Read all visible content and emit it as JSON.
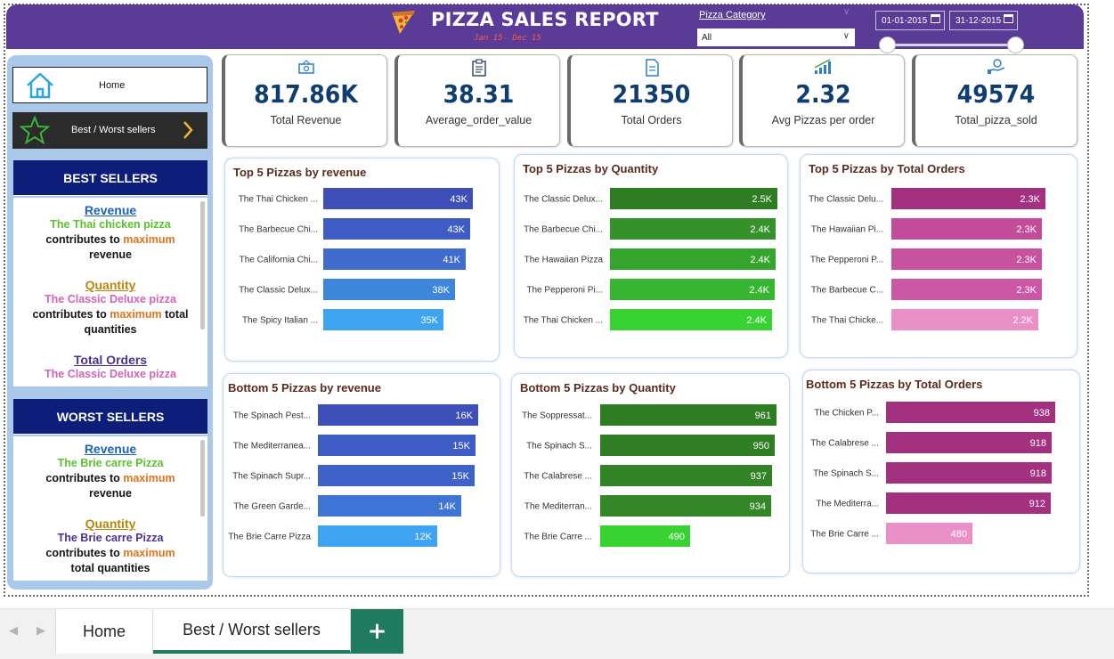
{
  "header": {
    "title": "PIZZA SALES REPORT",
    "subtitle": "Jan 15- Dec 15",
    "category_label": "Pizza Category",
    "category_value": "All",
    "date_from": "01-01-2015",
    "date_to": "31-12-2015",
    "colors": {
      "header_bg": "#5b3b98",
      "subtitle": "#ff5a3c"
    }
  },
  "nav": {
    "home_label": "Home",
    "best_worst_label": "Best / Worst sellers"
  },
  "best_sellers": {
    "header": "BEST SELLERS",
    "revenue_head": "Revenue",
    "revenue_item": "The Thai chicken pizza",
    "revenue_l1": "contributes to ",
    "revenue_l1b": "maximum",
    "revenue_l2": "revenue",
    "quantity_head": "Quantity",
    "quantity_item": "The Classic Deluxe pizza",
    "quantity_l1": "contributes to ",
    "quantity_l1b": "maximum",
    "quantity_l1c": " total",
    "quantity_l2": "quantities",
    "orders_head": "Total Orders",
    "orders_item": "The Classic Deluxe pizza"
  },
  "worst_sellers": {
    "header": "WORST SELLERS",
    "revenue_head": "Revenue",
    "revenue_item": "The Brie carre  Pizza",
    "revenue_l1": "contributes to ",
    "revenue_l1b": "maximum",
    "revenue_l2": "revenue",
    "quantity_head": "Quantity",
    "quantity_item": "The Brie carre  Pizza",
    "quantity_l1": "contributes to ",
    "quantity_l1b": "maximum",
    "quantity_l2": "total quantities"
  },
  "kpis": [
    {
      "value": "817.86K",
      "label": "Total Revenue",
      "icon": "money-icon"
    },
    {
      "value": "38.31",
      "label": "Average_order_value",
      "icon": "clipboard-icon"
    },
    {
      "value": "21350",
      "label": "Total Orders",
      "icon": "document-icon"
    },
    {
      "value": "2.32",
      "label": "Avg Pizzas per order",
      "icon": "bar-growth-icon"
    },
    {
      "value": "49574",
      "label": "Total_pizza_sold",
      "icon": "hand-money-icon"
    }
  ],
  "chart_data": [
    {
      "type": "bar",
      "title": "Top 5 Pizzas by revenue",
      "categories": [
        "The Thai Chicken ...",
        "The Barbecue Chi...",
        "The California Chi...",
        "The Classic Delux...",
        "The Spicy Italian ..."
      ],
      "values": [
        43434,
        42768,
        41410,
        38180,
        34831
      ],
      "labels": [
        "43K",
        "43K",
        "41K",
        "38K",
        "35K"
      ],
      "colors": [
        "#3e4fb8",
        "#3f5cc4",
        "#3f6ccd",
        "#3e86dc",
        "#3ea3f0"
      ]
    },
    {
      "type": "bar",
      "title": "Top 5 Pizzas by Quantity",
      "categories": [
        "The Classic Delux...",
        "The Barbecue Chi...",
        "The Hawaiian Pizza",
        "The Pepperoni Pi...",
        "The Thai Chicken ..."
      ],
      "values": [
        2453,
        2432,
        2422,
        2418,
        2371
      ],
      "labels": [
        "2.5K",
        "2.4K",
        "2.4K",
        "2.4K",
        "2.4K"
      ],
      "colors": [
        "#2e7d22",
        "#35922b",
        "#36a52e",
        "#38b530",
        "#39d233"
      ]
    },
    {
      "type": "bar",
      "title": "Top 5 Pizzas by Total Orders",
      "categories": [
        "The Classic Delu...",
        "The Hawaiian Pi...",
        "The Pepperoni P...",
        "The Barbecue C...",
        "The Thai Chicke..."
      ],
      "values": [
        2329,
        2280,
        2278,
        2273,
        2225
      ],
      "labels": [
        "2.3K",
        "2.3K",
        "2.3K",
        "2.3K",
        "2.2K"
      ],
      "colors": [
        "#a3317f",
        "#c24c9a",
        "#c752a0",
        "#cb58a5",
        "#ea8fc8"
      ]
    },
    {
      "type": "bar",
      "title": "Bottom 5 Pizzas by revenue",
      "categories": [
        "The Spinach Pest...",
        "The Mediterranea...",
        "The Spinach Supr...",
        "The Green Garde...",
        "The Brie Carre Pizza"
      ],
      "values": [
        15596,
        15360,
        15277,
        13956,
        11588
      ],
      "labels": [
        "16K",
        "15K",
        "15K",
        "14K",
        "12K"
      ],
      "colors": [
        "#3e4fb8",
        "#3f5cc4",
        "#3f62c8",
        "#3e74d4",
        "#3ea3f0"
      ]
    },
    {
      "type": "bar",
      "title": "Bottom 5 Pizzas by Quantity",
      "categories": [
        "The Soppressat...",
        "The Spinach S...",
        "The Calabrese ...",
        "The Mediterran...",
        "The Brie Carre ..."
      ],
      "values": [
        961,
        950,
        937,
        934,
        490
      ],
      "labels": [
        "961",
        "950",
        "937",
        "934",
        "490"
      ],
      "colors": [
        "#2e7d22",
        "#307f24",
        "#328226",
        "#348628",
        "#39d233"
      ]
    },
    {
      "type": "bar",
      "title": "Bottom 5 Pizzas by Total Orders",
      "categories": [
        "The Chicken P...",
        "The Calabrese ...",
        "The Spinach S...",
        "The Mediterra...",
        "The Brie Carre ..."
      ],
      "values": [
        938,
        918,
        918,
        912,
        480
      ],
      "labels": [
        "938",
        "918",
        "918",
        "912",
        "480"
      ],
      "colors": [
        "#a3317f",
        "#a3317f",
        "#a3317f",
        "#a3317f",
        "#ea8fc8"
      ]
    }
  ],
  "tabs": {
    "home": "Home",
    "best_worst": "Best / Worst sellers",
    "add": "+"
  }
}
